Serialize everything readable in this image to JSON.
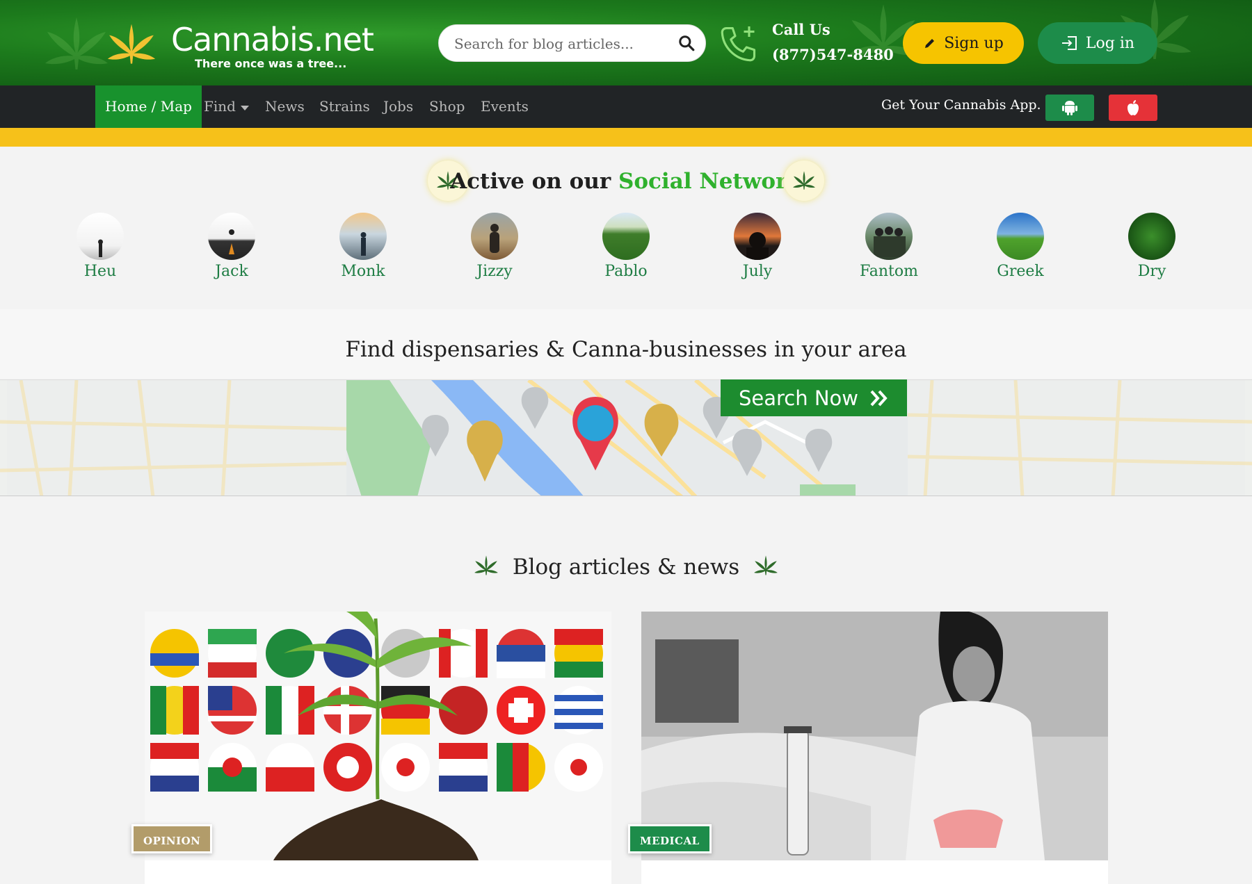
{
  "header": {
    "logo_name": "Cannabis.net",
    "logo_tagline": "There once was a tree...",
    "search_placeholder": "Search for blog articles...",
    "call_label": "Call Us",
    "phone": "(877)547-8480",
    "signup_label": "Sign up",
    "login_label": "Log in"
  },
  "nav": {
    "items": [
      "Home / Map",
      "Find",
      "News",
      "Strains",
      "Jobs",
      "Shop",
      "Events"
    ],
    "app_prompt": "Get Your Cannabis App."
  },
  "social": {
    "title_prefix": "Active on our ",
    "title_highlight": "Social Network",
    "members": [
      "Heu",
      "Jack",
      "Monk",
      "Jizzy",
      "Pablo",
      "July",
      "Fantom",
      "Greek",
      "Dry"
    ]
  },
  "find": {
    "title": "Find dispensaries & Canna-businesses in your area",
    "search_now_label": "Search Now"
  },
  "blog": {
    "title": "Blog articles & news",
    "cards": [
      {
        "category": "OPINION"
      },
      {
        "category": "MEDICAL"
      }
    ]
  },
  "colors": {
    "brand_green": "#18922d",
    "accent_yellow": "#f6c400",
    "nav_dark": "#212426",
    "apple_red": "#e53238"
  },
  "icons": [
    "search-icon",
    "phone-icon",
    "pencil-icon",
    "login-icon",
    "android-icon",
    "apple-icon",
    "cannabis-leaf-icon",
    "double-chevron-right-icon",
    "caret-down-icon"
  ]
}
